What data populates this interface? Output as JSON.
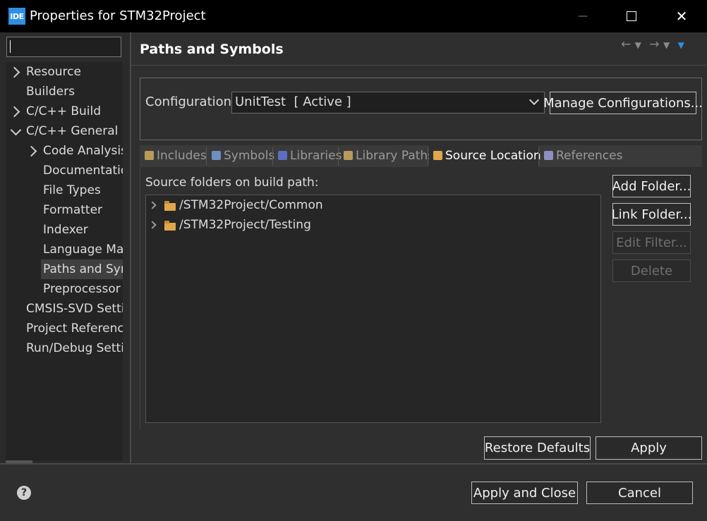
{
  "window": {
    "app_icon_text": "IDE",
    "title": "Properties for STM32Project",
    "minimize_glyph": "—",
    "maximize_glyph": "☐",
    "close_glyph": "✕"
  },
  "filter": {
    "value": ""
  },
  "tree": {
    "items": [
      {
        "label": "Resource",
        "expander": "right"
      },
      {
        "label": "Builders",
        "expander": ""
      },
      {
        "label": "C/C++ Build",
        "expander": "right"
      },
      {
        "label": "C/C++ General",
        "expander": "down"
      },
      {
        "label": "Code Analysis",
        "expander": "right"
      },
      {
        "label": "Documentation",
        "expander": ""
      },
      {
        "label": "File Types",
        "expander": ""
      },
      {
        "label": "Formatter",
        "expander": ""
      },
      {
        "label": "Indexer",
        "expander": ""
      },
      {
        "label": "Language Mappings",
        "expander": ""
      },
      {
        "label": "Paths and Symbols",
        "expander": "",
        "selected": true
      },
      {
        "label": "Preprocessor Include Paths",
        "expander": ""
      },
      {
        "label": "CMSIS-SVD Settings",
        "expander": ""
      },
      {
        "label": "Project References",
        "expander": ""
      },
      {
        "label": "Run/Debug Settings",
        "expander": ""
      }
    ]
  },
  "page": {
    "title": "Paths and Symbols",
    "nav": "🡐 ▾  🡒 ▾ ▾"
  },
  "config": {
    "label": "Configuration:",
    "value": "UnitTest  [ Active ]",
    "manage_button": "Manage Configurations..."
  },
  "tabs": [
    {
      "label": "Includes",
      "icon_color": "#b89a5a"
    },
    {
      "label": "Symbols",
      "icon_color": "#6f8fbf"
    },
    {
      "label": "Libraries",
      "icon_color": "#5a6fbf"
    },
    {
      "label": "Library Paths",
      "icon_color": "#b89a5a"
    },
    {
      "label": "Source Location",
      "icon_color": "#e0a64c",
      "active": true
    },
    {
      "label": "References",
      "icon_color": "#8f8fbf"
    }
  ],
  "source": {
    "label": "Source folders on build path:",
    "folders": [
      "/STM32Project/Common",
      "/STM32Project/Testing"
    ]
  },
  "side_buttons": {
    "add_folder": "Add Folder...",
    "link_folder": "Link Folder...",
    "edit_filter": "Edit Filter...",
    "delete": "Delete"
  },
  "actions": {
    "restore_defaults": "Restore Defaults",
    "apply": "Apply",
    "apply_and_close": "Apply and Close",
    "cancel": "Cancel",
    "help": "?"
  },
  "colors": {
    "background": "#2f2f2f",
    "titlebar": "#000000",
    "accent": "#2f8fe3",
    "folder": "#e0a64c"
  }
}
